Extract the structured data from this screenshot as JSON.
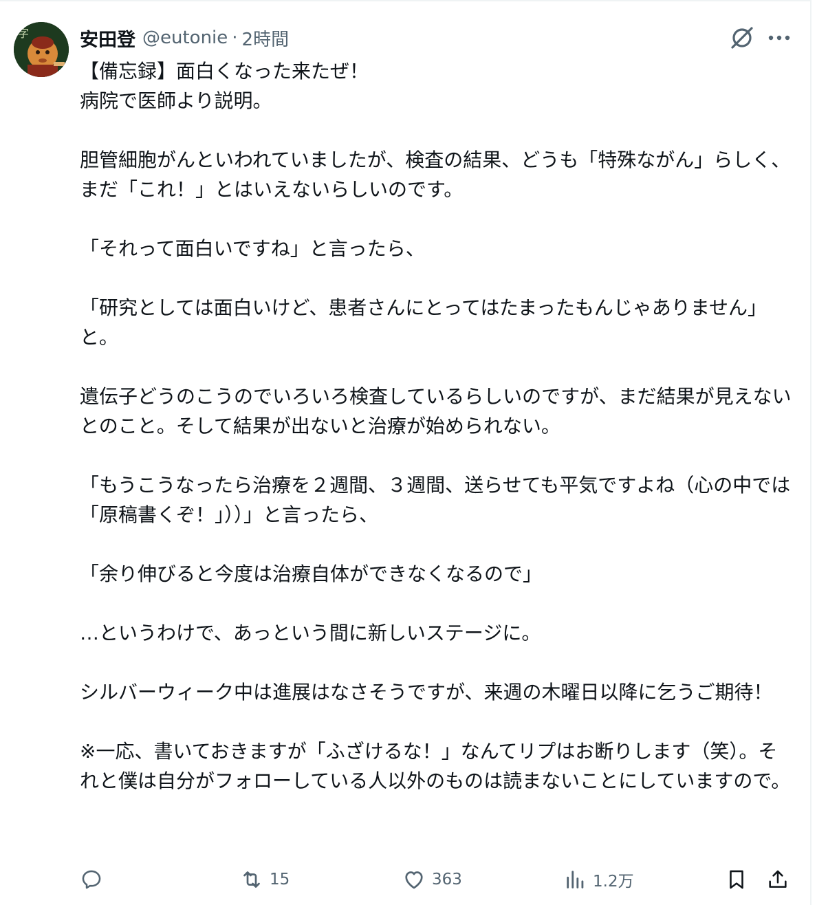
{
  "post": {
    "author": {
      "display_name": "安田登",
      "handle": "@eutonie",
      "separator": "·",
      "time": "2時間"
    },
    "paragraphs": [
      "【備忘録】面白くなった来たぜ！\n病院で医師より説明。",
      "胆管細胞がんといわれていましたが、検査の結果、どうも「特殊ながん」らしく、まだ「これ！」とはいえないらしいのです。",
      "「それって面白いですね」と言ったら、",
      "「研究としては面白いけど、患者さんにとってはたまったもんじゃありません」と。",
      "遺伝子どうのこうのでいろいろ検査しているらしいのですが、まだ結果が見えないとのこと。そして結果が出ないと治療が始められない。",
      "「もうこうなったら治療を２週間、３週間、送らせても平気ですよね（心の中では「原稿書くぞ！」））」と言ったら、",
      "「余り伸びると今度は治療自体ができなくなるので」",
      "…というわけで、あっという間に新しいステージに。",
      "シルバーウィーク中は進展はなさそうですが、来週の木曜日以降に乞うご期待！",
      "※一応、書いておきますが「ふざけるな！」なんてリプはお断りします（笑）。それと僕は自分がフォローしている人以外のものは読まないことにしていますので。"
    ]
  },
  "actions": {
    "reply": {
      "icon": "reply-icon",
      "count": ""
    },
    "repost": {
      "icon": "repost-icon",
      "count": "15"
    },
    "like": {
      "icon": "heart-icon",
      "count": "363"
    },
    "views": {
      "icon": "views-icon",
      "count": "1.2万"
    },
    "bookmark": {
      "icon": "bookmark-icon"
    },
    "share": {
      "icon": "share-icon"
    }
  },
  "colors": {
    "text": "#0f1419",
    "secondary": "#536471"
  }
}
